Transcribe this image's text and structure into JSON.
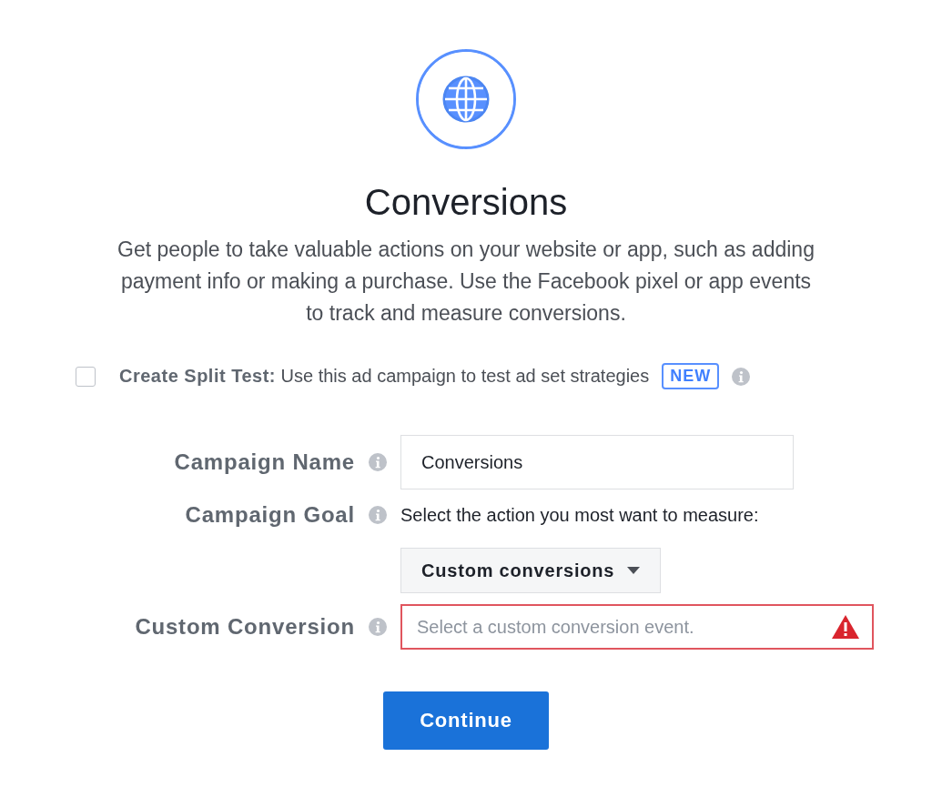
{
  "header": {
    "title": "Conversions",
    "description": "Get people to take valuable actions on your website or app, such as adding payment info or making a purchase. Use the Facebook pixel or app events to track and measure conversions."
  },
  "split_test": {
    "checked": false,
    "text": "**Create Split Test:** Use this ad campaign to test ad set strategies",
    "badge": "NEW"
  },
  "fields": [
    {
      "kind": "text",
      "label": "Campaign Name",
      "value": "Conversions"
    },
    {
      "kind": "select",
      "label": "Campaign Goal",
      "prompt": "Select the action you most want to measure:",
      "value": "Custom conversions"
    },
    {
      "kind": "combo",
      "label": "Custom Conversion",
      "placeholder": "Select a custom conversion event.",
      "error": true
    }
  ],
  "button": "Continue"
}
